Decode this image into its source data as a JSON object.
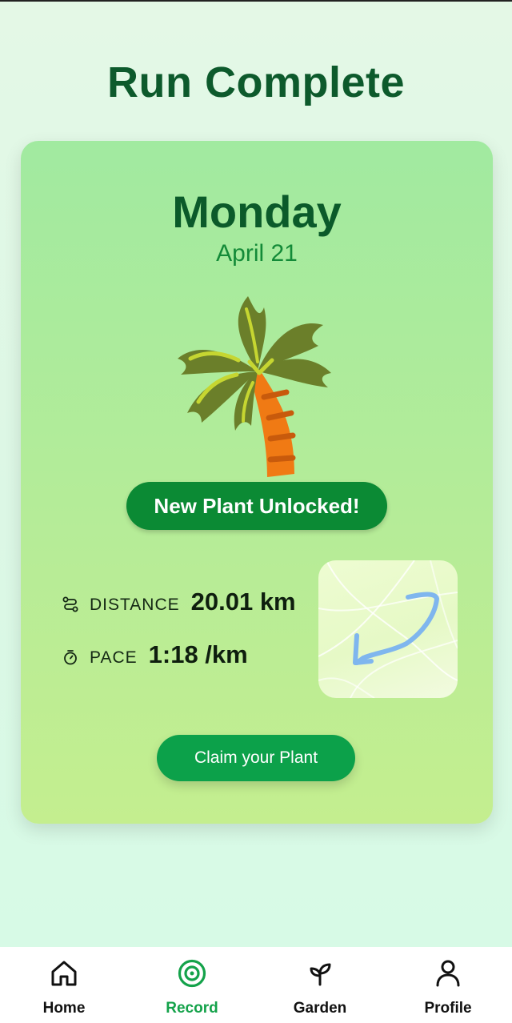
{
  "page": {
    "title": "Run Complete"
  },
  "card": {
    "day": "Monday",
    "date": "April 21",
    "unlock_label": "New Plant Unlocked!",
    "stats": {
      "distance": {
        "label": "DISTANCE",
        "value": "20.01 km",
        "icon": "route-icon"
      },
      "pace": {
        "label": "PACE",
        "value": "1:18 /km",
        "icon": "stopwatch-icon"
      }
    },
    "claim_label": "Claim your Plant"
  },
  "nav": {
    "items": [
      {
        "label": "Home",
        "icon": "home-icon",
        "active": false
      },
      {
        "label": "Record",
        "icon": "record-icon",
        "active": true
      },
      {
        "label": "Garden",
        "icon": "sprout-icon",
        "active": false
      },
      {
        "label": "Profile",
        "icon": "person-icon",
        "active": false
      }
    ]
  },
  "colors": {
    "title": "#0d5a2c",
    "accent": "#0ca14a",
    "pill": "#0b8a34",
    "active_nav": "#14a24a",
    "route": "#7fb6ee"
  }
}
